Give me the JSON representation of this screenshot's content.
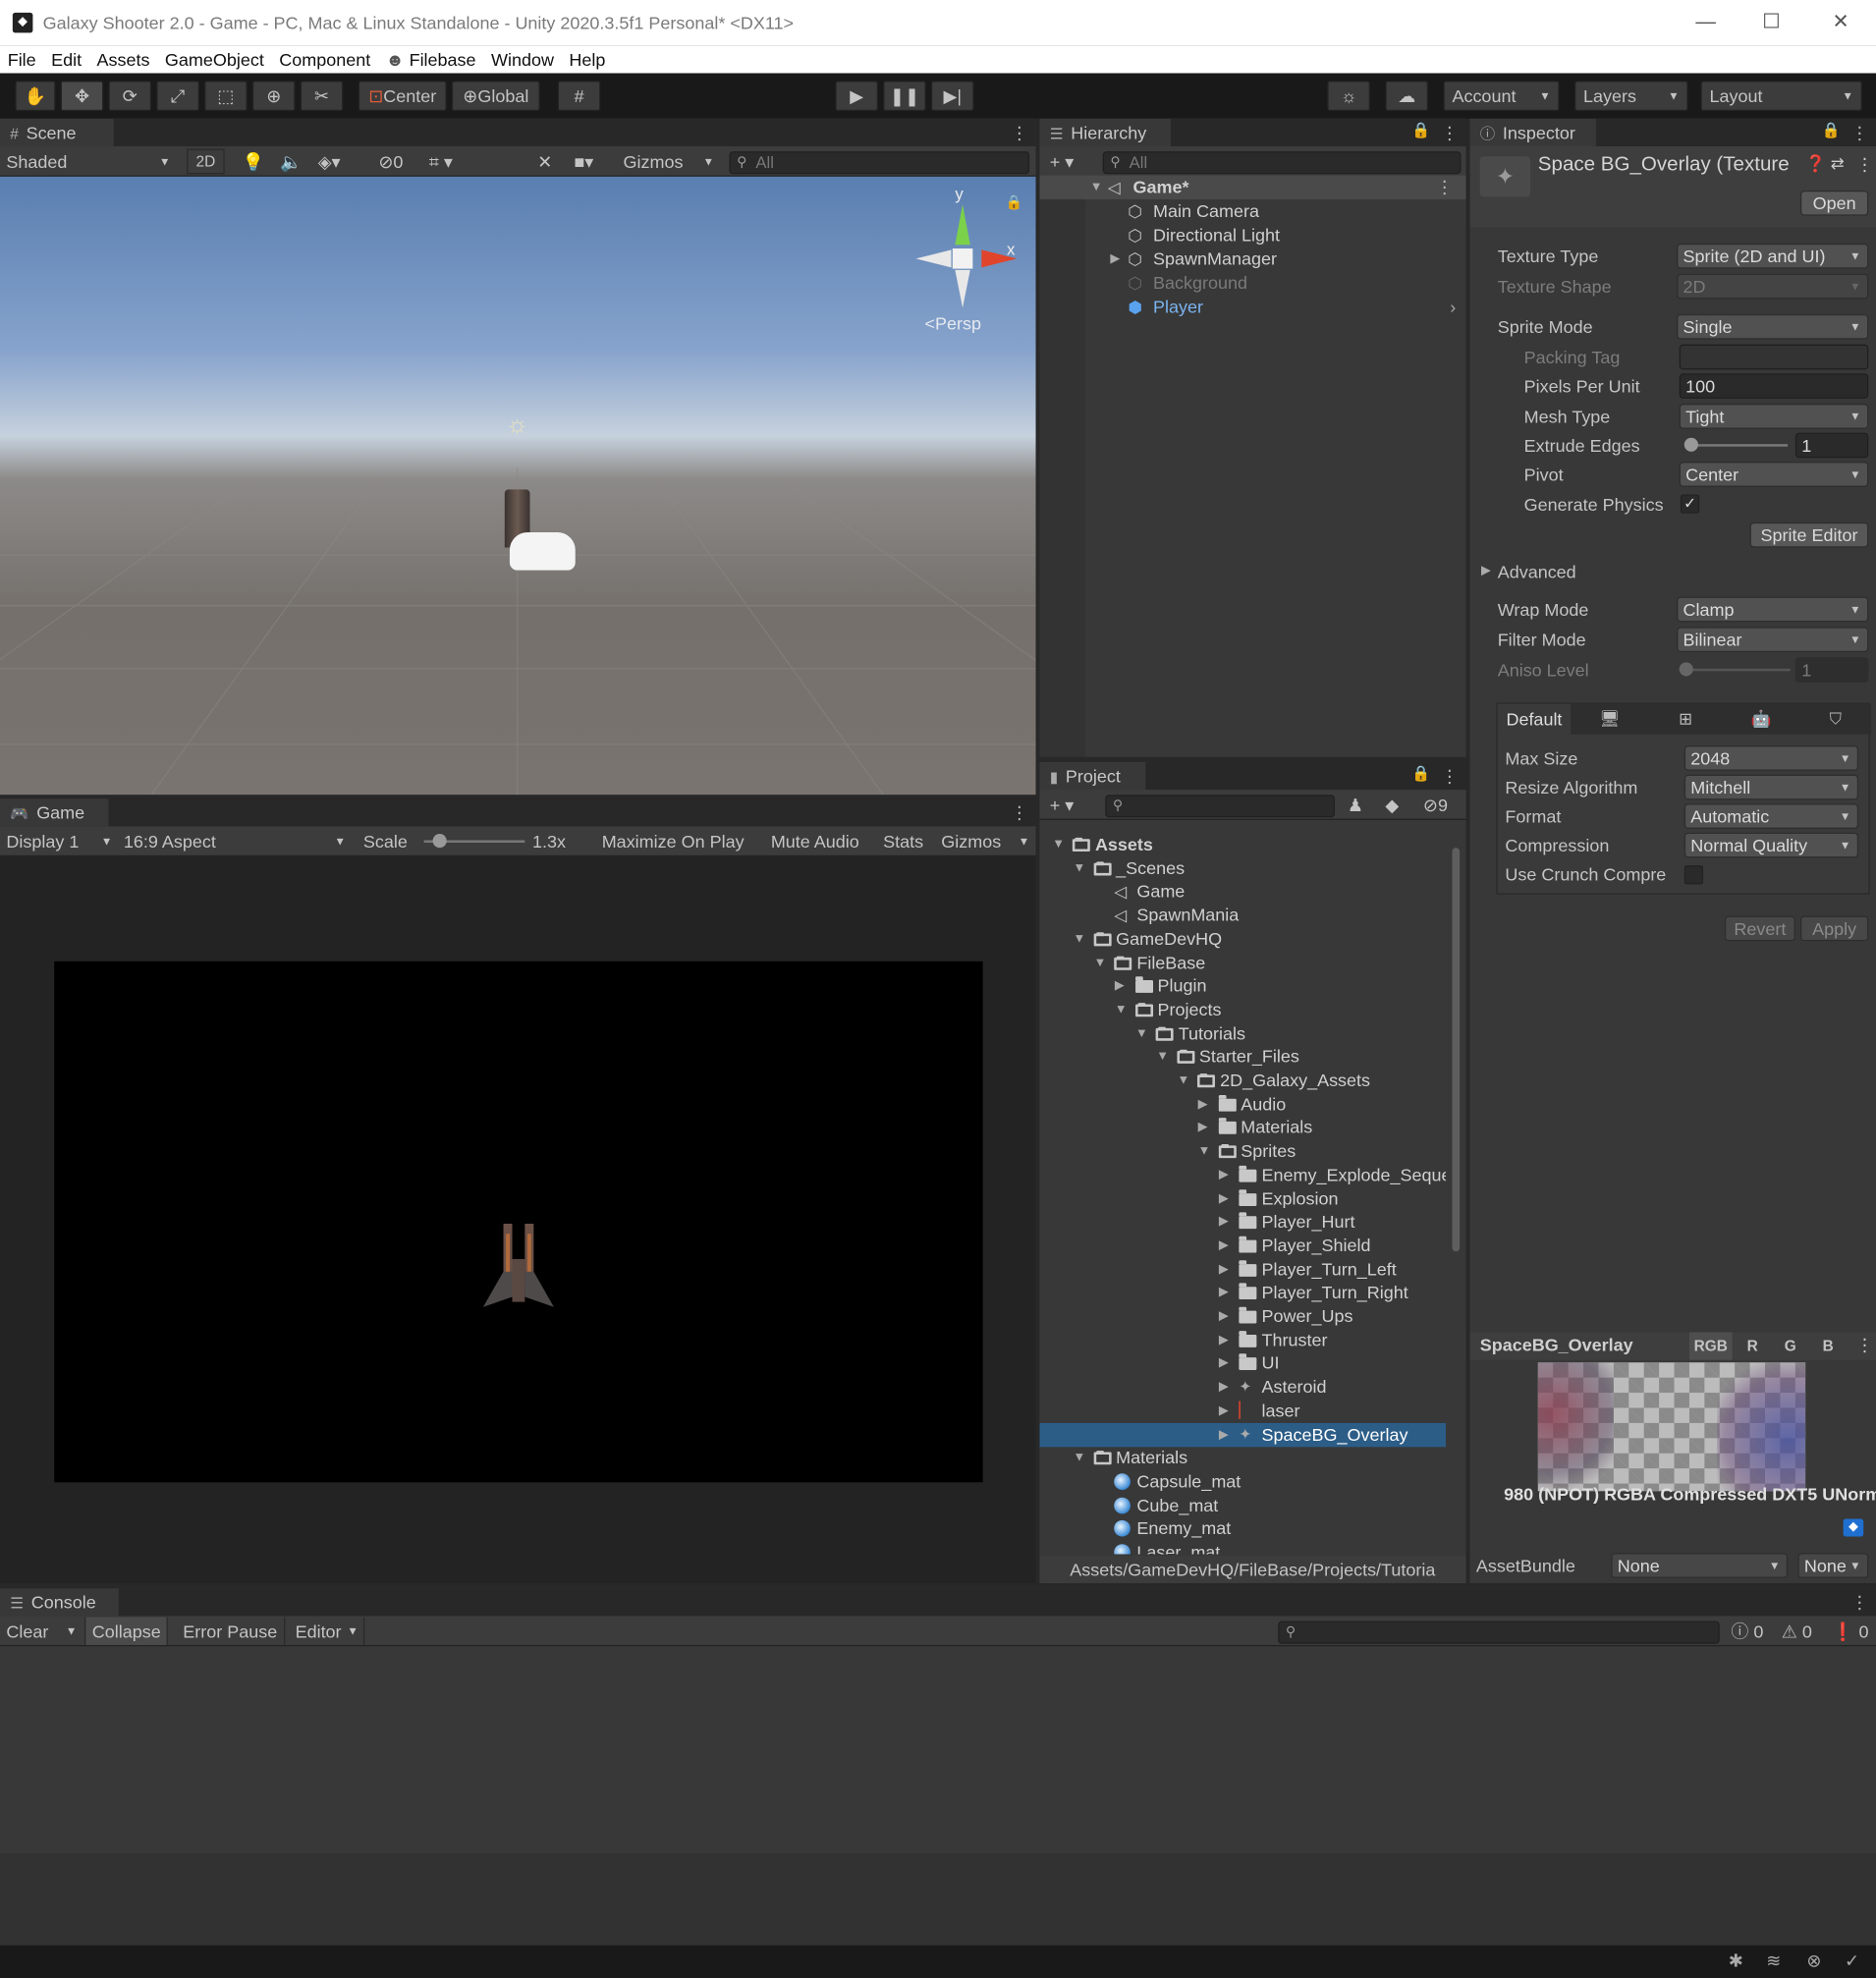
{
  "window": {
    "title": "Galaxy Shooter 2.0 - Game - PC, Mac & Linux Standalone - Unity 2020.3.5f1 Personal* <DX11>",
    "minimize": "—",
    "maximize": "☐",
    "close": "✕"
  },
  "menu": [
    "File",
    "Edit",
    "Assets",
    "GameObject",
    "Component",
    "Filebase",
    "Window",
    "Help"
  ],
  "toolbar": {
    "pivot": "Center",
    "space": "Global",
    "account": "Account",
    "layers": "Layers",
    "layout": "Layout"
  },
  "scene": {
    "tab": "Scene",
    "shading": "Shaded",
    "mode_2d": "2D",
    "hidden_count": "0",
    "gizmos": "Gizmos",
    "search_placeholder": "All",
    "axis_y": "y",
    "axis_x": "x",
    "persp": "<Persp"
  },
  "game": {
    "tab": "Game",
    "display": "Display 1",
    "aspect": "16:9 Aspect",
    "scale_label": "Scale",
    "scale_value": "1.3x",
    "scale_level": 0.1,
    "maximize": "Maximize On Play",
    "mute": "Mute Audio",
    "stats": "Stats",
    "gizmos": "Gizmos"
  },
  "hierarchy": {
    "tab": "Hierarchy",
    "search_placeholder": "All",
    "scene_name": "Game*",
    "items": [
      "Main Camera",
      "Directional Light",
      "SpawnManager",
      "Background",
      "Player"
    ]
  },
  "project": {
    "tab": "Project",
    "hidden_count": "9",
    "path": "Assets/GameDevHQ/FileBase/Projects/Tutoria",
    "tree": [
      "Assets",
      "_Scenes",
      "Game",
      "SpawnMania",
      "GameDevHQ",
      "FileBase",
      "Plugin",
      "Projects",
      "Tutorials",
      "Starter_Files",
      "2D_Galaxy_Assets",
      "Audio",
      "Materials",
      "Sprites",
      "Enemy_Explode_Seque",
      "Explosion",
      "Player_Hurt",
      "Player_Shield",
      "Player_Turn_Left",
      "Player_Turn_Right",
      "Power_Ups",
      "Thruster",
      "UI",
      "Asteroid",
      "laser",
      "SpaceBG_Overlay",
      "Materials",
      "Capsule_mat",
      "Cube_mat",
      "Enemy_mat",
      "Laser_mat"
    ]
  },
  "inspector": {
    "tab": "Inspector",
    "asset_title": "Space BG_Overlay (Texture",
    "open": "Open",
    "texture_type_label": "Texture Type",
    "texture_type": "Sprite (2D and UI)",
    "texture_shape_label": "Texture Shape",
    "texture_shape": "2D",
    "sprite_mode_label": "Sprite Mode",
    "sprite_mode": "Single",
    "packing_tag_label": "Packing Tag",
    "packing_tag": "",
    "ppu_label": "Pixels Per Unit",
    "ppu": "100",
    "mesh_type_label": "Mesh Type",
    "mesh_type": "Tight",
    "extrude_label": "Extrude Edges",
    "extrude": "1",
    "pivot_label": "Pivot",
    "pivot": "Center",
    "gen_physics_label": "Generate Physics",
    "gen_physics_check": "✓",
    "sprite_editor": "Sprite Editor",
    "advanced": "Advanced",
    "wrap_label": "Wrap Mode",
    "wrap": "Clamp",
    "filter_label": "Filter Mode",
    "filter": "Bilinear",
    "aniso_label": "Aniso Level",
    "aniso": "1",
    "platform_default": "Default",
    "max_size_label": "Max Size",
    "max_size": "2048",
    "resize_label": "Resize Algorithm",
    "resize": "Mitchell",
    "format_label": "Format",
    "format": "Automatic",
    "compression_label": "Compression",
    "compression": "Normal Quality",
    "crunch_label": "Use Crunch Compre",
    "revert": "Revert",
    "apply": "Apply",
    "preview_name": "SpaceBG_Overlay",
    "ch_rgb": "RGB",
    "ch_r": "R",
    "ch_g": "G",
    "ch_b": "B",
    "preview_info": "980 (NPOT)  RGBA Compressed DXT5 UNorm",
    "assetbundle_label": "AssetBundle",
    "assetbundle": "None",
    "assetbundle_variant": "None"
  },
  "console": {
    "tab": "Console",
    "clear": "Clear",
    "collapse": "Collapse",
    "error_pause": "Error Pause",
    "editor": "Editor",
    "count_log": "0",
    "count_warn": "0",
    "count_err": "0"
  }
}
